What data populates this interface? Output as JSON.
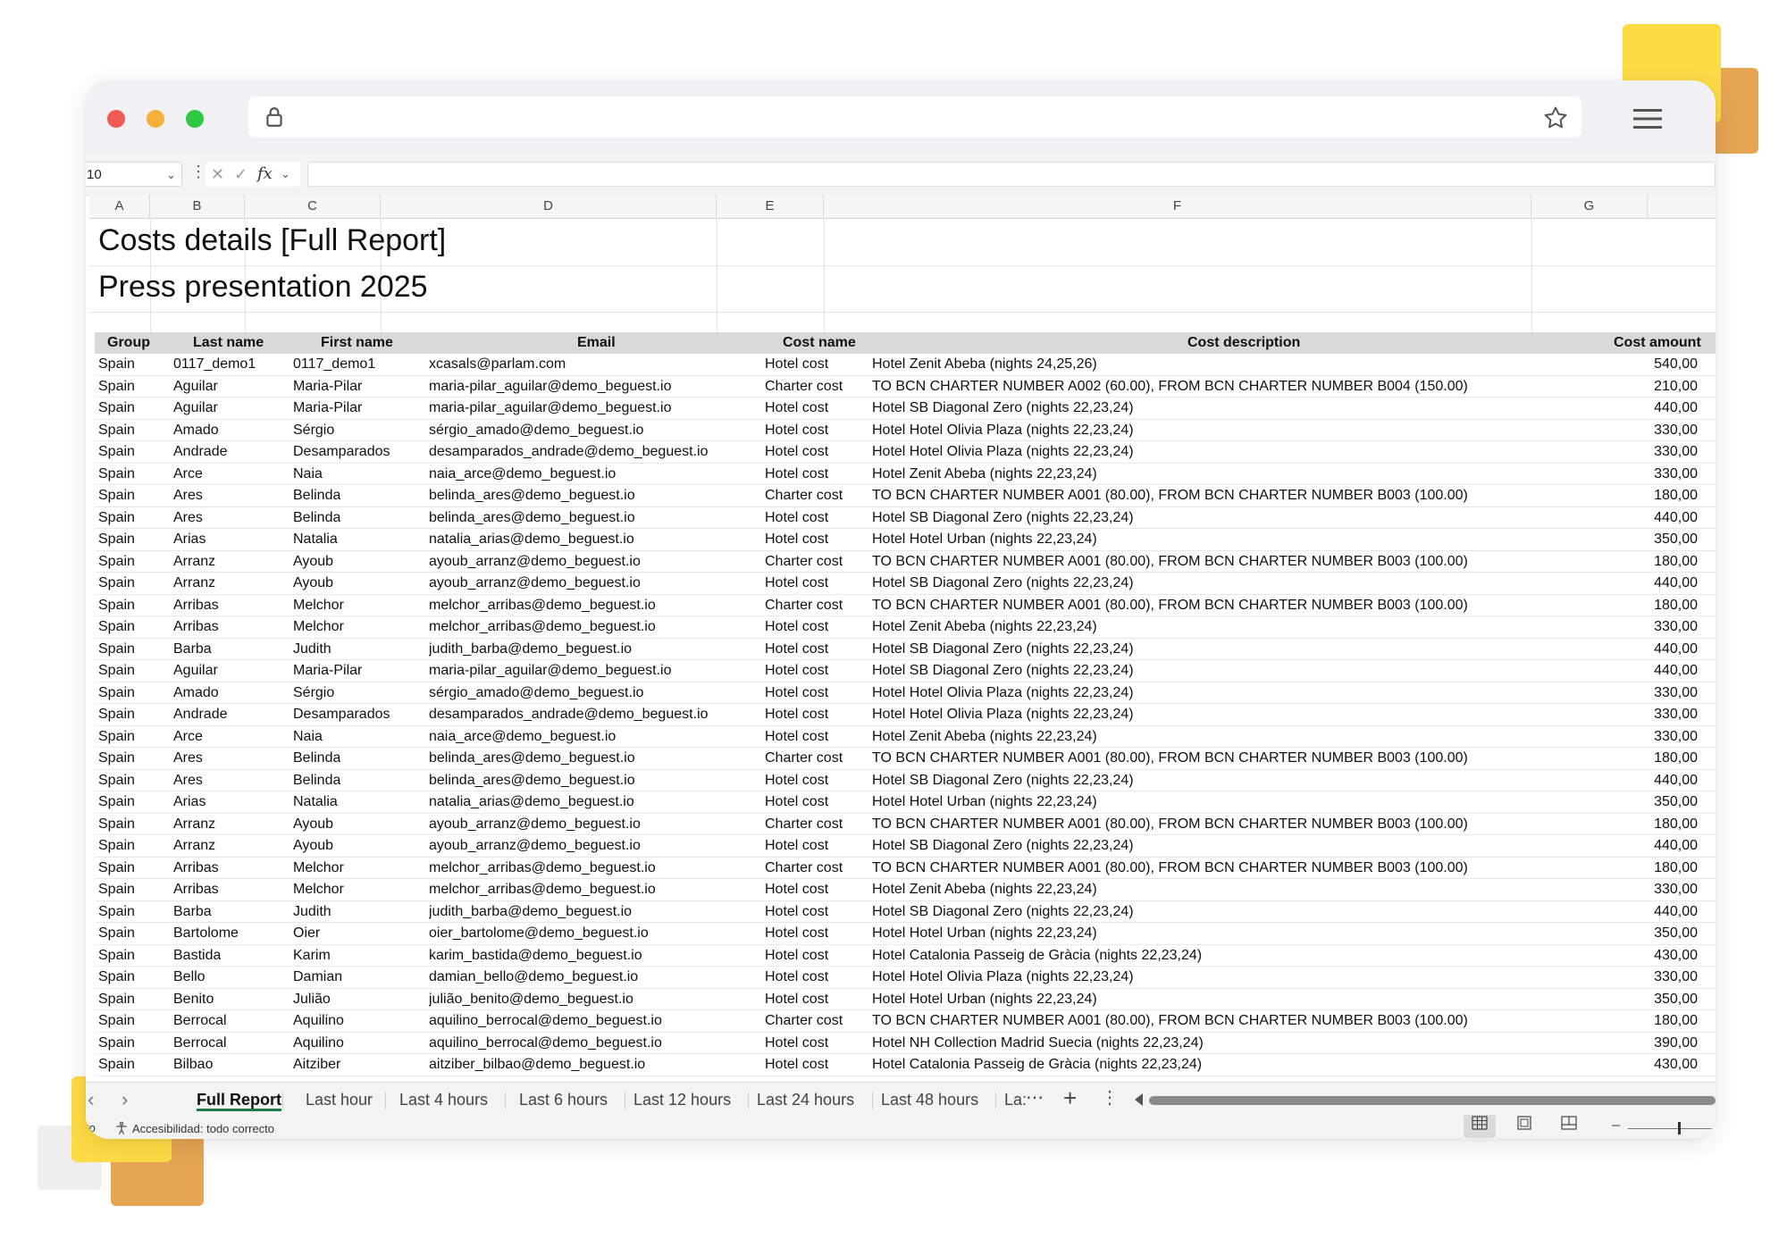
{
  "window": {
    "url": ""
  },
  "formula_bar": {
    "name_box": "10",
    "fx_label": "fx",
    "content": ""
  },
  "columns": [
    "A",
    "B",
    "C",
    "D",
    "E",
    "F",
    "G"
  ],
  "report": {
    "title": "Costs details [Full Report]",
    "subtitle": "Press presentation 2025"
  },
  "table": {
    "headers": [
      "Group",
      "Last name",
      "First name",
      "Email",
      "Cost name",
      "Cost description",
      "Cost amount"
    ],
    "rows": [
      [
        "Spain",
        "0117_demo1",
        "0117_demo1",
        "xcasals@parlam.com",
        "Hotel cost",
        "Hotel Zenit Abeba (nights 24,25,26)",
        "540,00"
      ],
      [
        "Spain",
        "Aguilar",
        "Maria-Pilar",
        "maria-pilar_aguilar@demo_beguest.io",
        "Charter cost",
        "TO BCN CHARTER NUMBER A002 (60.00), FROM BCN CHARTER NUMBER B004 (150.00)",
        "210,00"
      ],
      [
        "Spain",
        "Aguilar",
        "Maria-Pilar",
        "maria-pilar_aguilar@demo_beguest.io",
        "Hotel cost",
        "Hotel SB Diagonal Zero (nights 22,23,24)",
        "440,00"
      ],
      [
        "Spain",
        "Amado",
        "Sérgio",
        "sérgio_amado@demo_beguest.io",
        "Hotel cost",
        "Hotel Hotel Olivia Plaza (nights 22,23,24)",
        "330,00"
      ],
      [
        "Spain",
        "Andrade",
        "Desamparados",
        "desamparados_andrade@demo_beguest.io",
        "Hotel cost",
        "Hotel Hotel Olivia Plaza (nights 22,23,24)",
        "330,00"
      ],
      [
        "Spain",
        "Arce",
        "Naia",
        "naia_arce@demo_beguest.io",
        "Hotel cost",
        "Hotel Zenit Abeba (nights 22,23,24)",
        "330,00"
      ],
      [
        "Spain",
        "Ares",
        "Belinda",
        "belinda_ares@demo_beguest.io",
        "Charter cost",
        "TO BCN CHARTER NUMBER A001 (80.00), FROM BCN CHARTER NUMBER B003 (100.00)",
        "180,00"
      ],
      [
        "Spain",
        "Ares",
        "Belinda",
        "belinda_ares@demo_beguest.io",
        "Hotel cost",
        "Hotel SB Diagonal Zero (nights 22,23,24)",
        "440,00"
      ],
      [
        "Spain",
        "Arias",
        "Natalia",
        "natalia_arias@demo_beguest.io",
        "Hotel cost",
        "Hotel Hotel Urban (nights 22,23,24)",
        "350,00"
      ],
      [
        "Spain",
        "Arranz",
        "Ayoub",
        "ayoub_arranz@demo_beguest.io",
        "Charter cost",
        "TO BCN CHARTER NUMBER A001 (80.00), FROM BCN CHARTER NUMBER B003 (100.00)",
        "180,00"
      ],
      [
        "Spain",
        "Arranz",
        "Ayoub",
        "ayoub_arranz@demo_beguest.io",
        "Hotel cost",
        "Hotel SB Diagonal Zero (nights 22,23,24)",
        "440,00"
      ],
      [
        "Spain",
        "Arribas",
        "Melchor",
        "melchor_arribas@demo_beguest.io",
        "Charter cost",
        "TO BCN CHARTER NUMBER A001 (80.00), FROM BCN CHARTER NUMBER B003 (100.00)",
        "180,00"
      ],
      [
        "Spain",
        "Arribas",
        "Melchor",
        "melchor_arribas@demo_beguest.io",
        "Hotel cost",
        "Hotel Zenit Abeba (nights 22,23,24)",
        "330,00"
      ],
      [
        "Spain",
        "Barba",
        "Judith",
        "judith_barba@demo_beguest.io",
        "Hotel cost",
        "Hotel SB Diagonal Zero (nights 22,23,24)",
        "440,00"
      ],
      [
        "Spain",
        "Aguilar",
        "Maria-Pilar",
        "maria-pilar_aguilar@demo_beguest.io",
        "Hotel cost",
        "Hotel SB Diagonal Zero (nights 22,23,24)",
        "440,00"
      ],
      [
        "Spain",
        "Amado",
        "Sérgio",
        "sérgio_amado@demo_beguest.io",
        "Hotel cost",
        "Hotel Hotel Olivia Plaza (nights 22,23,24)",
        "330,00"
      ],
      [
        "Spain",
        "Andrade",
        "Desamparados",
        "desamparados_andrade@demo_beguest.io",
        "Hotel cost",
        "Hotel Hotel Olivia Plaza (nights 22,23,24)",
        "330,00"
      ],
      [
        "Spain",
        "Arce",
        "Naia",
        "naia_arce@demo_beguest.io",
        "Hotel cost",
        "Hotel Zenit Abeba (nights 22,23,24)",
        "330,00"
      ],
      [
        "Spain",
        "Ares",
        "Belinda",
        "belinda_ares@demo_beguest.io",
        "Charter cost",
        "TO BCN CHARTER NUMBER A001 (80.00), FROM BCN CHARTER NUMBER B003 (100.00)",
        "180,00"
      ],
      [
        "Spain",
        "Ares",
        "Belinda",
        "belinda_ares@demo_beguest.io",
        "Hotel cost",
        "Hotel SB Diagonal Zero (nights 22,23,24)",
        "440,00"
      ],
      [
        "Spain",
        "Arias",
        "Natalia",
        "natalia_arias@demo_beguest.io",
        "Hotel cost",
        "Hotel Hotel Urban (nights 22,23,24)",
        "350,00"
      ],
      [
        "Spain",
        "Arranz",
        "Ayoub",
        "ayoub_arranz@demo_beguest.io",
        "Charter cost",
        "TO BCN CHARTER NUMBER A001 (80.00), FROM BCN CHARTER NUMBER B003 (100.00)",
        "180,00"
      ],
      [
        "Spain",
        "Arranz",
        "Ayoub",
        "ayoub_arranz@demo_beguest.io",
        "Hotel cost",
        "Hotel SB Diagonal Zero (nights 22,23,24)",
        "440,00"
      ],
      [
        "Spain",
        "Arribas",
        "Melchor",
        "melchor_arribas@demo_beguest.io",
        "Charter cost",
        "TO BCN CHARTER NUMBER A001 (80.00), FROM BCN CHARTER NUMBER B003 (100.00)",
        "180,00"
      ],
      [
        "Spain",
        "Arribas",
        "Melchor",
        "melchor_arribas@demo_beguest.io",
        "Hotel cost",
        "Hotel Zenit Abeba (nights 22,23,24)",
        "330,00"
      ],
      [
        "Spain",
        "Barba",
        "Judith",
        "judith_barba@demo_beguest.io",
        "Hotel cost",
        "Hotel SB Diagonal Zero (nights 22,23,24)",
        "440,00"
      ],
      [
        "Spain",
        "Bartolome",
        "Oier",
        "oier_bartolome@demo_beguest.io",
        "Hotel cost",
        "Hotel Hotel Urban (nights 22,23,24)",
        "350,00"
      ],
      [
        "Spain",
        "Bastida",
        "Karim",
        "karim_bastida@demo_beguest.io",
        "Hotel cost",
        "Hotel Catalonia Passeig de Gràcia (nights 22,23,24)",
        "430,00"
      ],
      [
        "Spain",
        "Bello",
        "Damian",
        "damian_bello@demo_beguest.io",
        "Hotel cost",
        "Hotel Hotel Olivia Plaza (nights 22,23,24)",
        "330,00"
      ],
      [
        "Spain",
        "Benito",
        "Julião",
        "julião_benito@demo_beguest.io",
        "Hotel cost",
        "Hotel Hotel Urban (nights 22,23,24)",
        "350,00"
      ],
      [
        "Spain",
        "Berrocal",
        "Aquilino",
        "aquilino_berrocal@demo_beguest.io",
        "Charter cost",
        "TO BCN CHARTER NUMBER A001 (80.00), FROM BCN CHARTER NUMBER B003 (100.00)",
        "180,00"
      ],
      [
        "Spain",
        "Berrocal",
        "Aquilino",
        "aquilino_berrocal@demo_beguest.io",
        "Hotel cost",
        "Hotel NH Collection Madrid Suecia (nights 22,23,24)",
        "390,00"
      ],
      [
        "Spain",
        "Bilbao",
        "Aitziber",
        "aitziber_bilbao@demo_beguest.io",
        "Hotel cost",
        "Hotel Catalonia Passeig de Gràcia (nights 22,23,24)",
        "430,00"
      ]
    ]
  },
  "sheet_tabs": {
    "items": [
      "Full Report",
      "Last hour",
      "Last 4 hours",
      "Last 6 hours",
      "Last 12 hours",
      "Last 24 hours",
      "Last 48 hours",
      "La:"
    ],
    "active": "Full Report"
  },
  "status_bar": {
    "ready_fragment": "to",
    "accessibility": "Accesibilidad: todo correcto"
  },
  "icons": [
    "lock-icon",
    "star-icon",
    "hamburger-menu-icon",
    "chevron-down-icon",
    "cancel-icon",
    "check-icon",
    "fx-icon",
    "accessibility-icon",
    "normal-view-icon",
    "page-layout-icon",
    "page-break-icon"
  ],
  "colors": {
    "header_fill": "#d9d9d9",
    "active_tab_underline": "#1f7a43",
    "deco_yellow": "#fddb45",
    "deco_orange": "#e5a553"
  }
}
